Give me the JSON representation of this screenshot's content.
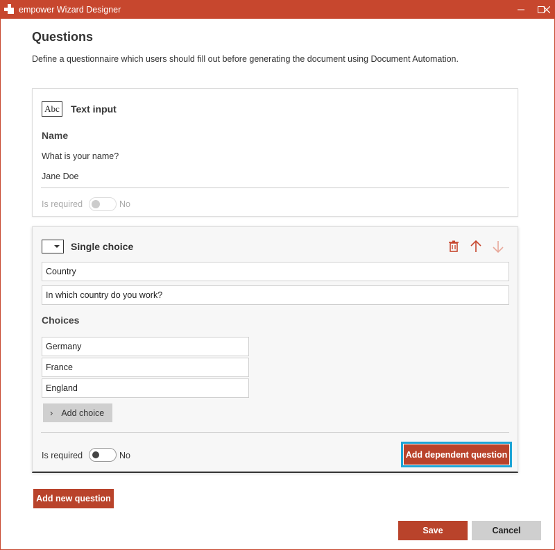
{
  "window": {
    "title": "empower Wizard Designer",
    "accent": "#c7472e"
  },
  "page": {
    "title": "Questions",
    "description": "Define a questionnaire which users should fill out before generating the document using Document Automation."
  },
  "questions": [
    {
      "type_icon": "abc-text-icon",
      "type_icon_text": "Abc",
      "type_label": "Text input",
      "name": "Name",
      "question": "What is your name?",
      "default_value": "Jane Doe",
      "is_required_label": "Is required",
      "is_required_state": "No"
    },
    {
      "type_icon": "dropdown-icon",
      "type_label": "Single choice",
      "name_value": "Country",
      "question_value": "In which country do you work?",
      "choices_label": "Choices",
      "choices": [
        "Germany",
        "France",
        "England"
      ],
      "add_choice_label": "Add choice",
      "is_required_label": "Is required",
      "is_required_state": "No",
      "add_dependent_label": "Add dependent question"
    }
  ],
  "actions": {
    "add_new_question": "Add new question",
    "save": "Save",
    "cancel": "Cancel"
  }
}
